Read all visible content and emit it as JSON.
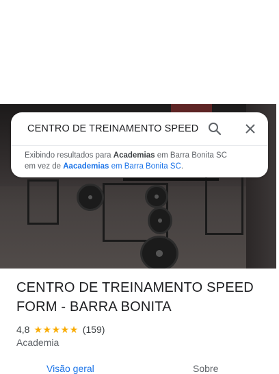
{
  "search": {
    "query": "CENTRO DE TREINAMENTO SPEED F",
    "notice_prefix": "Exibindo resultados para ",
    "notice_term": "Academias",
    "notice_mid": " em Barra Bonita SC",
    "notice_line2_prefix": "em vez de ",
    "notice_original_term": "Aacademias",
    "notice_original_rest": " em Barra Bonita SC",
    "notice_end": "."
  },
  "place": {
    "title": "CENTRO DE TREINAMENTO SPEED FORM - BARRA BONITA",
    "rating": "4,8",
    "stars": 5,
    "reviews": "(159)",
    "category": "Academia"
  },
  "tabs": [
    {
      "label": "Visão geral",
      "active": true
    },
    {
      "label": "Sobre",
      "active": false
    }
  ],
  "colors": {
    "accent": "#1a73e8",
    "star": "#f9ab00",
    "text": "#202124"
  },
  "icons": [
    "search-icon",
    "close-icon",
    "star-icon"
  ]
}
